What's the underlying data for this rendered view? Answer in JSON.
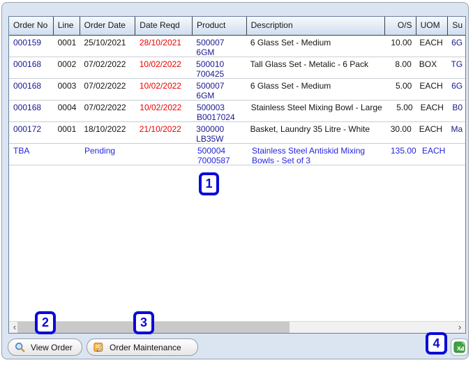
{
  "table": {
    "columns": [
      {
        "key": "order_no",
        "label": "Order No"
      },
      {
        "key": "line",
        "label": "Line"
      },
      {
        "key": "order_date",
        "label": "Order Date"
      },
      {
        "key": "date_reqd",
        "label": "Date Reqd"
      },
      {
        "key": "product",
        "label": "Product"
      },
      {
        "key": "description",
        "label": "Description"
      },
      {
        "key": "os",
        "label": "O/S"
      },
      {
        "key": "uom",
        "label": "UOM"
      },
      {
        "key": "supplier",
        "label": "Su"
      }
    ],
    "rows": [
      {
        "order_no": "000159",
        "line": "0001",
        "order_date": "25/10/2021",
        "date_reqd": "28/10/2021",
        "product_line1": "500007",
        "product_line2": "6GM",
        "description": "6 Glass Set - Medium",
        "os": "10.00",
        "uom": "EACH",
        "supplier": "6G"
      },
      {
        "order_no": "000168",
        "line": "0002",
        "order_date": "07/02/2022",
        "date_reqd": "10/02/2022",
        "product_line1": "500010",
        "product_line2": "700425",
        "description": "Tall Glass Set - Metalic - 6 Pack",
        "os": "8.00",
        "uom": "BOX",
        "supplier": "TG"
      },
      {
        "order_no": "000168",
        "line": "0003",
        "order_date": "07/02/2022",
        "date_reqd": "10/02/2022",
        "product_line1": "500007",
        "product_line2": "6GM",
        "description": "6 Glass Set - Medium",
        "os": "5.00",
        "uom": "EACH",
        "supplier": "6G"
      },
      {
        "order_no": "000168",
        "line": "0004",
        "order_date": "07/02/2022",
        "date_reqd": "10/02/2022",
        "product_line1": "500003",
        "product_line2": "B0017024",
        "description": "Stainless Steel Mixing Bowl - Large",
        "os": "5.00",
        "uom": "EACH",
        "supplier": "B0"
      },
      {
        "order_no": "000172",
        "line": "0001",
        "order_date": "18/10/2022",
        "date_reqd": "21/10/2022",
        "product_line1": "300000",
        "product_line2": "LB35W",
        "description": "Basket, Laundry 35 Litre - White",
        "os": "30.00",
        "uom": "EACH",
        "supplier": "Ma"
      },
      {
        "order_no": "TBA",
        "line": "",
        "order_date": "Pending",
        "date_reqd": "",
        "product_line1": "500004",
        "product_line2": "7000587",
        "description": "Stainless Steel Antiskid Mixing Bowls - Set of 3",
        "os": "135.00",
        "uom": "EACH",
        "supplier": ""
      }
    ]
  },
  "scrollbar": {
    "left_arrow": "‹",
    "right_arrow": "›"
  },
  "buttons": {
    "view_order": {
      "label": "View Order",
      "icon": "magnifier-icon"
    },
    "order_maintenance": {
      "label": "Order Maintenance",
      "icon": "note-edit-icon"
    },
    "export_excel": {
      "icon": "excel-icon"
    }
  },
  "callouts": [
    {
      "label": "1"
    },
    {
      "label": "2"
    },
    {
      "label": "3"
    },
    {
      "label": "4"
    }
  ],
  "colors": {
    "callout_blue": "#0a0ada",
    "overdue_red": "#ea0000",
    "order_navy": "#19198f",
    "pending_blue": "#2424e0",
    "window_bg": "#dbe5f1",
    "excel_green": "#3fa33f"
  }
}
